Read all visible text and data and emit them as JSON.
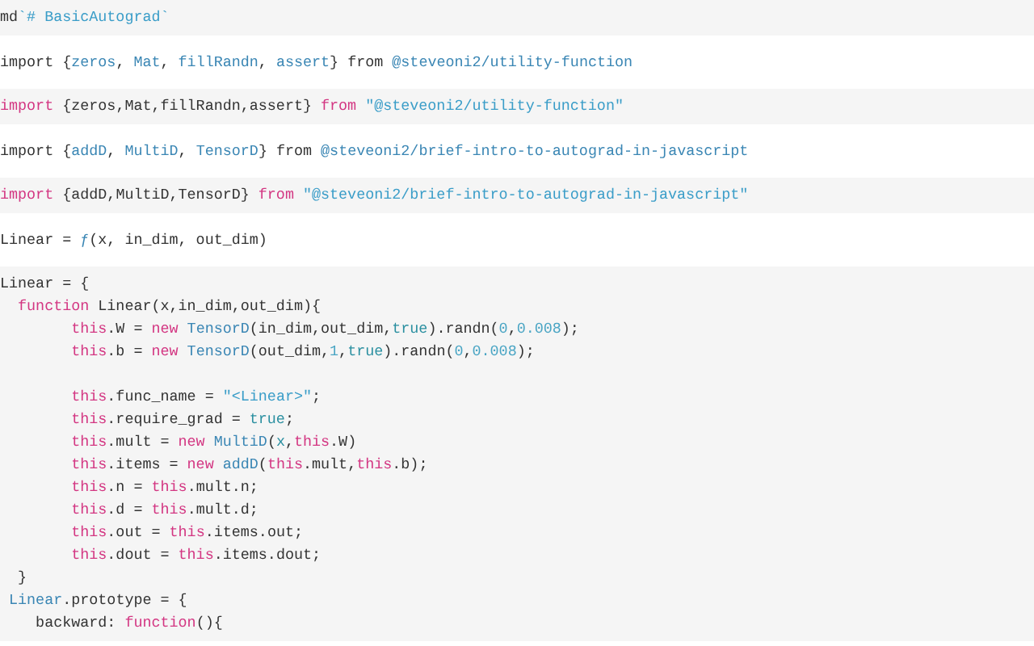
{
  "cells": [
    {
      "source": [
        {
          "tokens": [
            {
              "kind": "plain",
              "text": "md"
            },
            {
              "kind": "string",
              "text": "`# BasicAutograd`"
            }
          ]
        }
      ]
    },
    {
      "output": {
        "tokens": [
          {
            "kind": "plain",
            "text": "import {"
          },
          {
            "kind": "name",
            "text": "zeros"
          },
          {
            "kind": "plain",
            "text": ", "
          },
          {
            "kind": "name",
            "text": "Mat"
          },
          {
            "kind": "plain",
            "text": ", "
          },
          {
            "kind": "name",
            "text": "fillRandn"
          },
          {
            "kind": "plain",
            "text": ", "
          },
          {
            "kind": "name",
            "text": "assert"
          },
          {
            "kind": "plain",
            "text": "} from "
          },
          {
            "kind": "name",
            "text": "@steveoni2/utility-function"
          }
        ]
      },
      "source": [
        {
          "tokens": [
            {
              "kind": "keyword",
              "text": "import"
            },
            {
              "kind": "plain",
              "text": " {zeros,Mat,fillRandn,assert} "
            },
            {
              "kind": "keyword",
              "text": "from"
            },
            {
              "kind": "string",
              "text": " \"@steveoni2/utility-function\""
            }
          ]
        }
      ]
    },
    {
      "output": {
        "tokens": [
          {
            "kind": "plain",
            "text": "import {"
          },
          {
            "kind": "name",
            "text": "addD"
          },
          {
            "kind": "plain",
            "text": ", "
          },
          {
            "kind": "name",
            "text": "MultiD"
          },
          {
            "kind": "plain",
            "text": ", "
          },
          {
            "kind": "name",
            "text": "TensorD"
          },
          {
            "kind": "plain",
            "text": "} from "
          },
          {
            "kind": "name",
            "text": "@steveoni2/brief-intro-to-autograd-in-javascript"
          }
        ]
      },
      "source": [
        {
          "tokens": [
            {
              "kind": "keyword",
              "text": "import"
            },
            {
              "kind": "plain",
              "text": " {addD,MultiD,TensorD} "
            },
            {
              "kind": "keyword",
              "text": "from"
            },
            {
              "kind": "string",
              "text": " \"@steveoni2/brief-intro-to-autograd-in-javascript\""
            }
          ]
        }
      ]
    },
    {
      "output": {
        "tokens": [
          {
            "kind": "plain",
            "text": "Linear = "
          },
          {
            "kind": "name",
            "text": "ƒ"
          },
          {
            "kind": "plain",
            "text": "(x, in_dim, out_dim)"
          }
        ]
      },
      "source": [
        {
          "tokens": [
            {
              "kind": "plain",
              "text": "Linear = {"
            }
          ]
        },
        {
          "tokens": [
            {
              "kind": "keyword",
              "text": "  function"
            },
            {
              "kind": "plain",
              "text": " Linear(x,in_dim,out_dim){"
            }
          ]
        },
        {
          "tokens": [
            {
              "kind": "keyword",
              "text": "        this"
            },
            {
              "kind": "plain",
              "text": ".W = "
            },
            {
              "kind": "keyword",
              "text": "new"
            },
            {
              "kind": "name",
              "text": " TensorD"
            },
            {
              "kind": "plain",
              "text": "(in_dim,out_dim,"
            },
            {
              "kind": "literal",
              "text": "true"
            },
            {
              "kind": "plain",
              "text": ").randn("
            },
            {
              "kind": "number",
              "text": "0"
            },
            {
              "kind": "plain",
              "text": ","
            },
            {
              "kind": "number",
              "text": "0.008"
            },
            {
              "kind": "plain",
              "text": ");"
            }
          ]
        },
        {
          "tokens": [
            {
              "kind": "keyword",
              "text": "        this"
            },
            {
              "kind": "plain",
              "text": ".b = "
            },
            {
              "kind": "keyword",
              "text": "new"
            },
            {
              "kind": "name",
              "text": " TensorD"
            },
            {
              "kind": "plain",
              "text": "(out_dim,"
            },
            {
              "kind": "number",
              "text": "1"
            },
            {
              "kind": "plain",
              "text": ","
            },
            {
              "kind": "literal",
              "text": "true"
            },
            {
              "kind": "plain",
              "text": ").randn("
            },
            {
              "kind": "number",
              "text": "0"
            },
            {
              "kind": "plain",
              "text": ","
            },
            {
              "kind": "number",
              "text": "0.008"
            },
            {
              "kind": "plain",
              "text": ");"
            }
          ]
        },
        {
          "blank_before": true,
          "tokens": [
            {
              "kind": "keyword",
              "text": "        this"
            },
            {
              "kind": "plain",
              "text": ".func_name = "
            },
            {
              "kind": "string",
              "text": "\"<Linear>\""
            },
            {
              "kind": "plain",
              "text": ";"
            }
          ]
        },
        {
          "tokens": [
            {
              "kind": "keyword",
              "text": "        this"
            },
            {
              "kind": "plain",
              "text": ".require_grad = "
            },
            {
              "kind": "literal",
              "text": "true"
            },
            {
              "kind": "plain",
              "text": ";"
            }
          ]
        },
        {
          "tokens": [
            {
              "kind": "keyword",
              "text": "        this"
            },
            {
              "kind": "plain",
              "text": ".mult = "
            },
            {
              "kind": "keyword",
              "text": "new"
            },
            {
              "kind": "name",
              "text": " MultiD"
            },
            {
              "kind": "plain",
              "text": "("
            },
            {
              "kind": "literal",
              "text": "x"
            },
            {
              "kind": "plain",
              "text": ","
            },
            {
              "kind": "keyword",
              "text": "this"
            },
            {
              "kind": "plain",
              "text": ".W)"
            }
          ]
        },
        {
          "tokens": [
            {
              "kind": "keyword",
              "text": "        this"
            },
            {
              "kind": "plain",
              "text": ".items = "
            },
            {
              "kind": "keyword",
              "text": "new"
            },
            {
              "kind": "name",
              "text": " addD"
            },
            {
              "kind": "plain",
              "text": "("
            },
            {
              "kind": "keyword",
              "text": "this"
            },
            {
              "kind": "plain",
              "text": ".mult,"
            },
            {
              "kind": "keyword",
              "text": "this"
            },
            {
              "kind": "plain",
              "text": ".b);"
            }
          ]
        },
        {
          "tokens": [
            {
              "kind": "keyword",
              "text": "        this"
            },
            {
              "kind": "plain",
              "text": ".n = "
            },
            {
              "kind": "keyword",
              "text": "this"
            },
            {
              "kind": "plain",
              "text": ".mult.n;"
            }
          ]
        },
        {
          "tokens": [
            {
              "kind": "keyword",
              "text": "        this"
            },
            {
              "kind": "plain",
              "text": ".d = "
            },
            {
              "kind": "keyword",
              "text": "this"
            },
            {
              "kind": "plain",
              "text": ".mult.d;"
            }
          ]
        },
        {
          "tokens": [
            {
              "kind": "keyword",
              "text": "        this"
            },
            {
              "kind": "plain",
              "text": ".out = "
            },
            {
              "kind": "keyword",
              "text": "this"
            },
            {
              "kind": "plain",
              "text": ".items.out;"
            }
          ]
        },
        {
          "tokens": [
            {
              "kind": "keyword",
              "text": "        this"
            },
            {
              "kind": "plain",
              "text": ".dout = "
            },
            {
              "kind": "keyword",
              "text": "this"
            },
            {
              "kind": "plain",
              "text": ".items.dout;"
            }
          ]
        },
        {
          "tokens": [
            {
              "kind": "plain",
              "text": "  }"
            }
          ]
        },
        {
          "tokens": [
            {
              "kind": "name",
              "text": " Linear"
            },
            {
              "kind": "plain",
              "text": ".prototype = {"
            }
          ]
        },
        {
          "tokens": [
            {
              "kind": "plain",
              "text": "    backward: "
            },
            {
              "kind": "keyword",
              "text": "function"
            },
            {
              "kind": "plain",
              "text": "(){"
            }
          ]
        }
      ]
    }
  ]
}
